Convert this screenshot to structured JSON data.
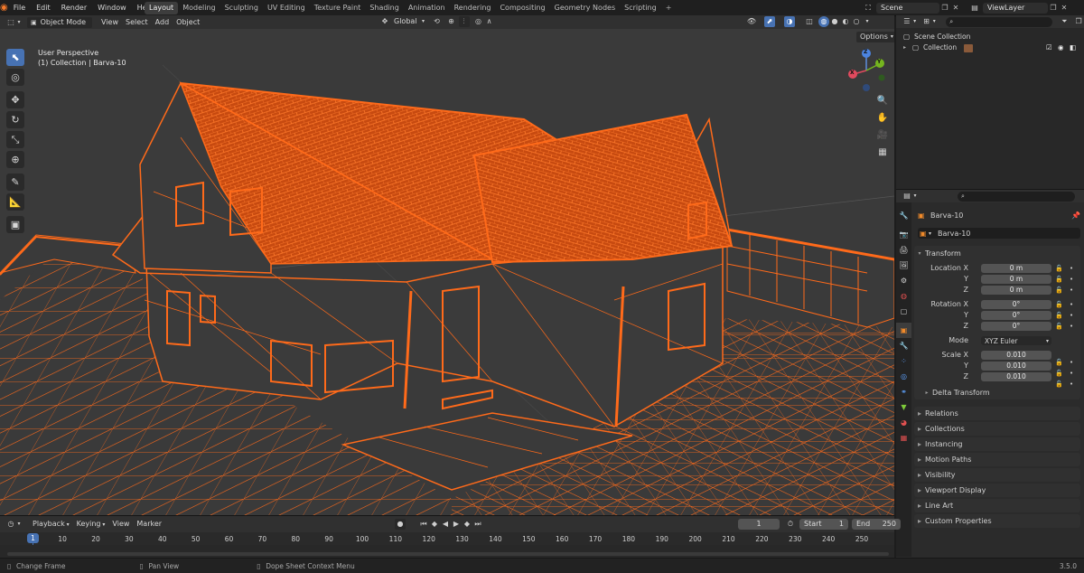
{
  "menu": [
    "File",
    "Edit",
    "Render",
    "Window",
    "Help"
  ],
  "workspaces": [
    "Layout",
    "Modeling",
    "Sculpting",
    "UV Editing",
    "Texture Paint",
    "Shading",
    "Animation",
    "Rendering",
    "Compositing",
    "Geometry Nodes",
    "Scripting"
  ],
  "topright": {
    "scene": "Scene",
    "viewlayer": "ViewLayer"
  },
  "header": {
    "mode": "Object Mode",
    "menus": [
      "View",
      "Select",
      "Add",
      "Object"
    ],
    "orientation": "Global",
    "options": "Options"
  },
  "viewport": {
    "title": "User Perspective",
    "subtitle": "(1) Collection | Barva-10",
    "gizmo": {
      "z": "Z",
      "x": "X",
      "y": "Y"
    }
  },
  "outliner": {
    "root": "Scene Collection",
    "child": "Collection"
  },
  "properties": {
    "object_name": "Barva-10",
    "data_name": "Barva-10",
    "transform_label": "Transform",
    "location_label": "Location X",
    "rotation_label": "Rotation X",
    "scale_label": "Scale X",
    "y": "Y",
    "z": "Z",
    "location": [
      "0 m",
      "0 m",
      "0 m"
    ],
    "rotation": [
      "0°",
      "0°",
      "0°"
    ],
    "mode_label": "Mode",
    "mode_value": "XYZ Euler",
    "scale": [
      "0.010",
      "0.010",
      "0.010"
    ],
    "delta": "Delta Transform",
    "sections": [
      "Relations",
      "Collections",
      "Instancing",
      "Motion Paths",
      "Visibility",
      "Viewport Display",
      "Line Art",
      "Custom Properties"
    ]
  },
  "timeline": {
    "menus": [
      "Playback",
      "Keying",
      "View",
      "Marker"
    ],
    "current": "1",
    "start_label": "Start",
    "start": "1",
    "end_label": "End",
    "end": "250",
    "playhead": "1",
    "ticks": [
      "10",
      "20",
      "30",
      "40",
      "50",
      "60",
      "70",
      "80",
      "90",
      "100",
      "110",
      "120",
      "130",
      "140",
      "150",
      "160",
      "170",
      "180",
      "190",
      "200",
      "210",
      "220",
      "230",
      "240",
      "250"
    ]
  },
  "status": {
    "left": "Change Frame",
    "middle": "Pan View",
    "right": "Dope Sheet Context Menu",
    "version": "3.5.0"
  },
  "colors": {
    "accent": "#4772b3",
    "wire": "#ff6a1a",
    "selected_outline": "#f08a2a"
  }
}
